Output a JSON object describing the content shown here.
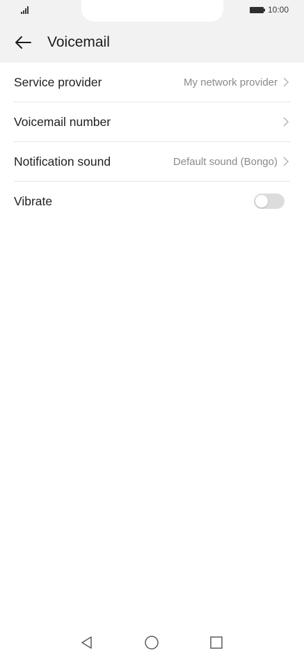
{
  "status_bar": {
    "time": "10:00",
    "icons": [
      "signal-icon",
      "battery-icon"
    ]
  },
  "header": {
    "title": "Voicemail",
    "back_icon": "arrow-left-icon"
  },
  "settings": {
    "items": [
      {
        "label": "Service provider",
        "value": "My network provider",
        "type": "link"
      },
      {
        "label": "Voicemail number",
        "value": "",
        "type": "link"
      },
      {
        "label": "Notification sound",
        "value": "Default sound (Bongo)",
        "type": "link"
      },
      {
        "label": "Vibrate",
        "value": "",
        "type": "toggle",
        "enabled": false
      }
    ]
  },
  "navigation": {
    "buttons": [
      "back-triangle-icon",
      "home-circle-icon",
      "recents-square-icon"
    ]
  },
  "colors": {
    "header_bg": "#f2f2f2",
    "text_primary": "#1f1f1f",
    "text_secondary": "#8a8a8a",
    "toggle_off": "#dcdcdc"
  }
}
